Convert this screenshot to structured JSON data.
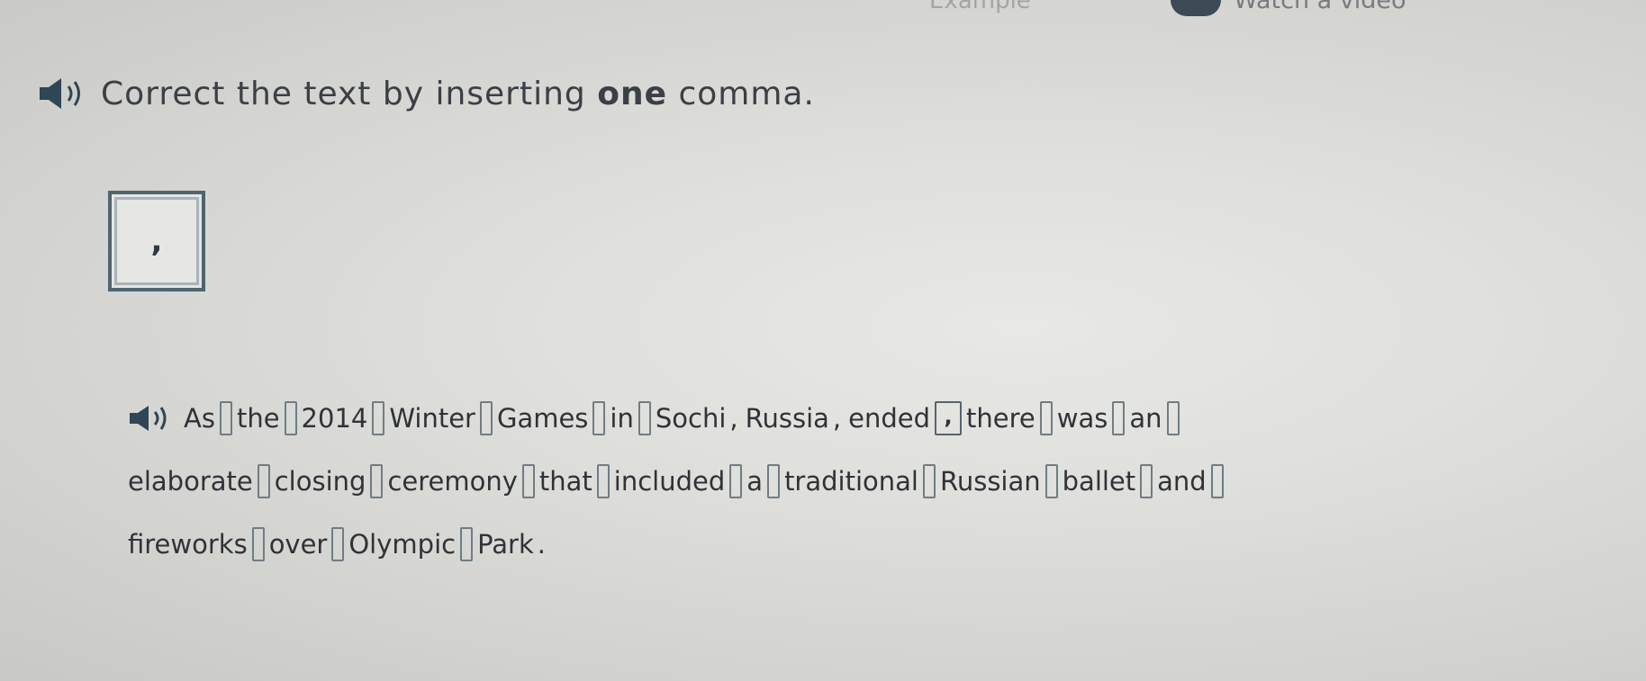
{
  "top": {
    "fragment_text": "Example",
    "watch_video_label": "Watch a video"
  },
  "instruction": {
    "before": "Correct the text by inserting ",
    "bold": "one",
    "after": " comma."
  },
  "tile": {
    "symbol": ","
  },
  "sentence": {
    "line1": [
      "As",
      "the",
      "2014",
      "Winter",
      "Games",
      "in",
      "Sochi",
      "Russia",
      "ended",
      "there",
      "was",
      "an"
    ],
    "line2": [
      "elaborate",
      "closing",
      "ceremony",
      "that",
      "included",
      "a",
      "traditional",
      "Russian",
      "ballet",
      "and"
    ],
    "line3": [
      "fireworks",
      "over",
      "Olympic",
      "Park"
    ],
    "inserted_comma": ",",
    "comma": ",",
    "period": "."
  },
  "colors": {
    "accent": "#4f6470",
    "text": "#2f3338",
    "background": "#dfdfdb"
  },
  "icons": {
    "audio": "speaker-icon"
  }
}
